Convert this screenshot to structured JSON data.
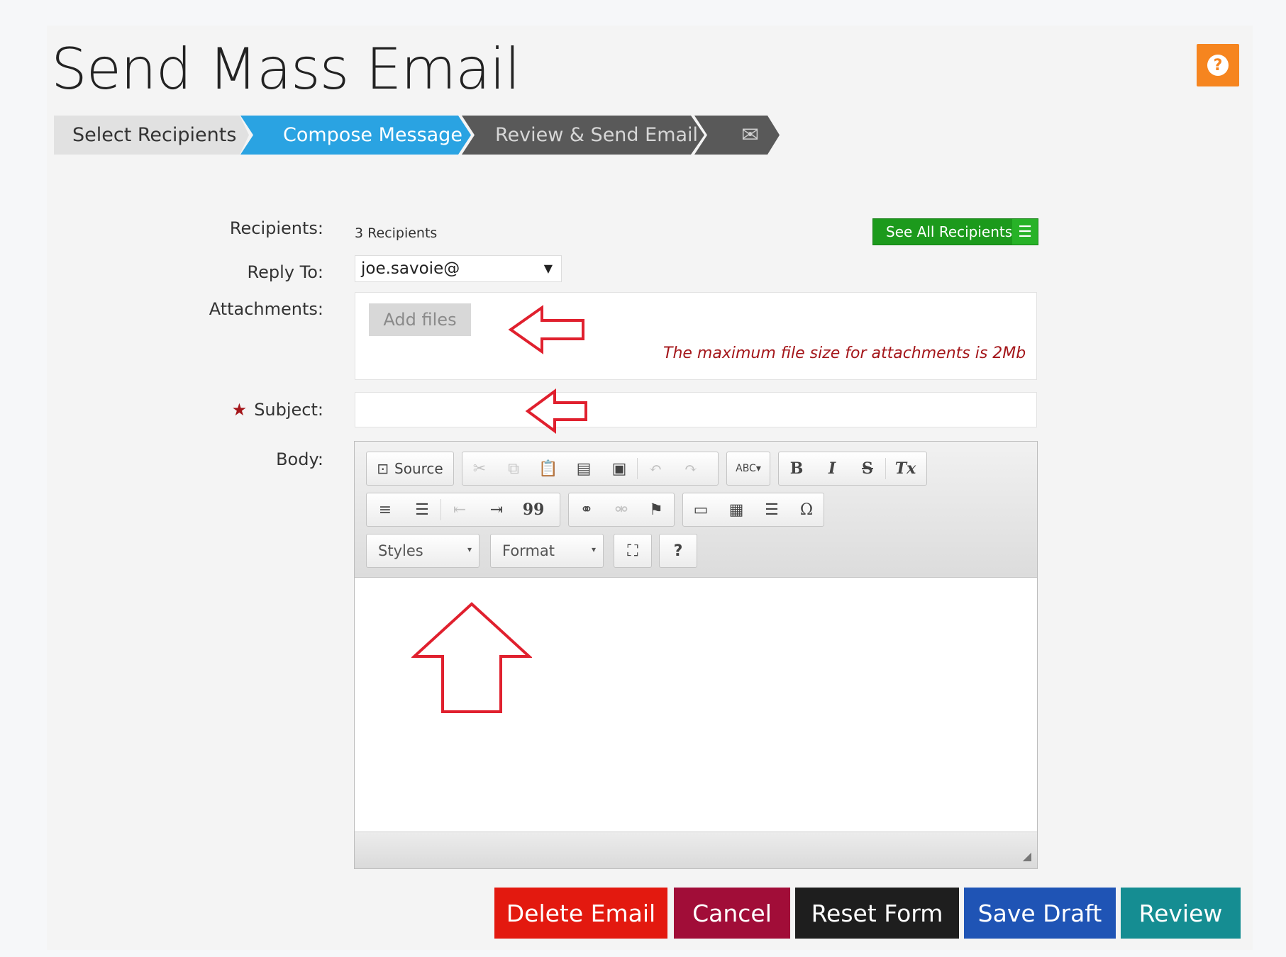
{
  "page": {
    "title": "Send Mass Email",
    "help_icon": "question-icon"
  },
  "wizard": {
    "steps": [
      {
        "label": "Select Recipients"
      },
      {
        "label": "Compose Message"
      },
      {
        "label": "Review & Send Email"
      },
      {
        "label": "✉"
      }
    ],
    "colors": {
      "inactive": "#e1e1e1",
      "active": "#2aa3e2",
      "dark": "#595959"
    }
  },
  "form": {
    "recipients_label": "Recipients:",
    "recipients_count": "3 Recipients",
    "see_all_label": "See All Recipients",
    "reply_to_label": "Reply To:",
    "reply_to_value": "joe.savoie@",
    "attachments_label": "Attachments:",
    "add_files_label": "Add files",
    "max_size_note": "The maximum file size for attachments is 2Mb",
    "subject_label": "Subject:",
    "required_marker": "★",
    "body_label": "Body:"
  },
  "editor": {
    "source_label": "Source",
    "styles_label": "Styles",
    "format_label": "Format",
    "help_glyph": "?",
    "bold": "B",
    "italic": "I",
    "strike": "S",
    "remove_format": "Tx",
    "omega": "Ω",
    "quote": "99",
    "spell": "ABC"
  },
  "actions": {
    "delete_label": "Delete Email",
    "cancel_label": "Cancel",
    "reset_label": "Reset Form",
    "save_label": "Save Draft",
    "review_label": "Review"
  },
  "colors": {
    "delete": "#e3190f",
    "cancel": "#a10d38",
    "reset": "#1e1e1e",
    "save": "#1f54b5",
    "review": "#158d92",
    "help": "#f6851f",
    "see_all": "#1c9a1c",
    "annotation_arrow": "#e0202e"
  }
}
